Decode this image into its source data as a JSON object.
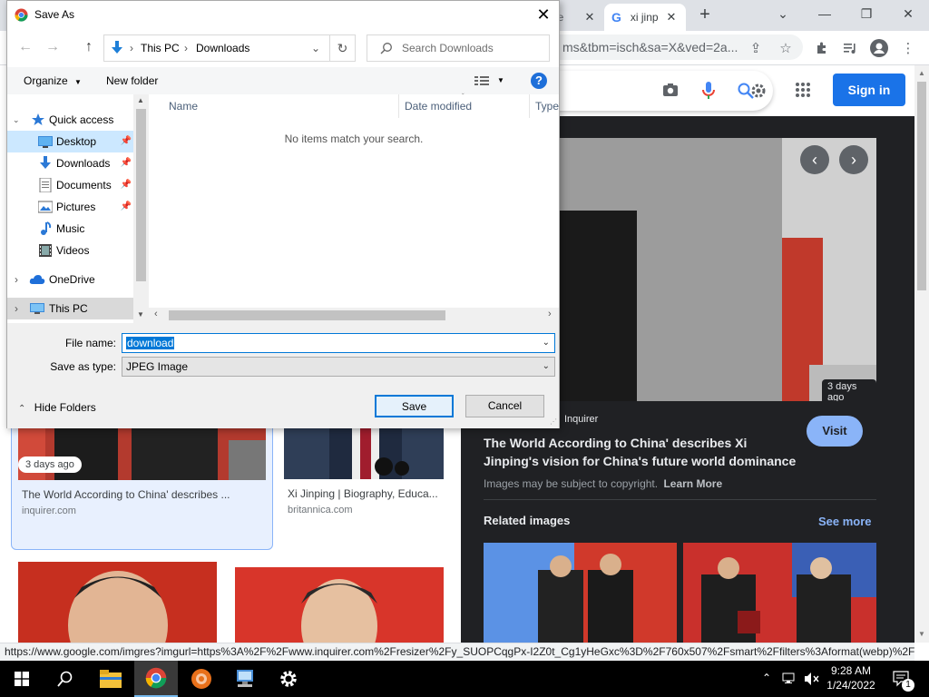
{
  "browser": {
    "tabs": [
      {
        "label": "ee"
      },
      {
        "label": "xi jinp"
      }
    ],
    "new_tab_glyph": "+",
    "url_text": "ms&tbm=isch&sa=X&ved=2a...",
    "status_url": "https://www.google.com/imgres?imgurl=https%3A%2F%2Fwww.inquirer.com%2Fresizer%2Fy_SUOPCqgPx-I2Z0t_Cg1yHeGxc%3D%2F760x507%2Fsmart%2Ffilters%3Aformat(webp)%2F..."
  },
  "google": {
    "sign_in_label": "Sign in",
    "results": [
      {
        "title": "The World According to China' describes ...",
        "source": "inquirer.com",
        "badge": "3 days ago"
      },
      {
        "title": "Xi Jinping | Biography, Educa...",
        "source": "britannica.com"
      }
    ],
    "preview": {
      "badge": "3 days ago",
      "source": "Inquirer",
      "visit_label": "Visit",
      "title": "The World According to China' describes Xi Jinping's vision for China's future world dominance",
      "copyright_note": "Images may be subject to copyright.",
      "learn_more": "Learn More",
      "related_label": "Related images",
      "see_more_label": "See more"
    }
  },
  "dialog": {
    "title": "Save As",
    "path": [
      "This PC",
      "Downloads"
    ],
    "search_placeholder": "Search Downloads",
    "organize_label": "Organize",
    "new_folder_label": "New folder",
    "columns": [
      "Name",
      "Date modified",
      "Type"
    ],
    "empty_message": "No items match your search.",
    "nav": {
      "quick_access": "Quick access",
      "items": [
        "Desktop",
        "Downloads",
        "Documents",
        "Pictures",
        "Music",
        "Videos"
      ],
      "onedrive": "OneDrive",
      "this_pc": "This PC"
    },
    "file_name_label": "File name:",
    "file_name_value": "download",
    "save_type_label": "Save as type:",
    "save_type_value": "JPEG Image",
    "hide_folders_label": "Hide Folders",
    "save_label": "Save",
    "cancel_label": "Cancel"
  },
  "taskbar": {
    "time": "9:28 AM",
    "date": "1/24/2022",
    "notification_count": "1"
  },
  "colors": {
    "accent": "#1a73e8",
    "dark_panel": "#202124",
    "selection": "#cce8ff",
    "text_selection": "#0078d7"
  }
}
